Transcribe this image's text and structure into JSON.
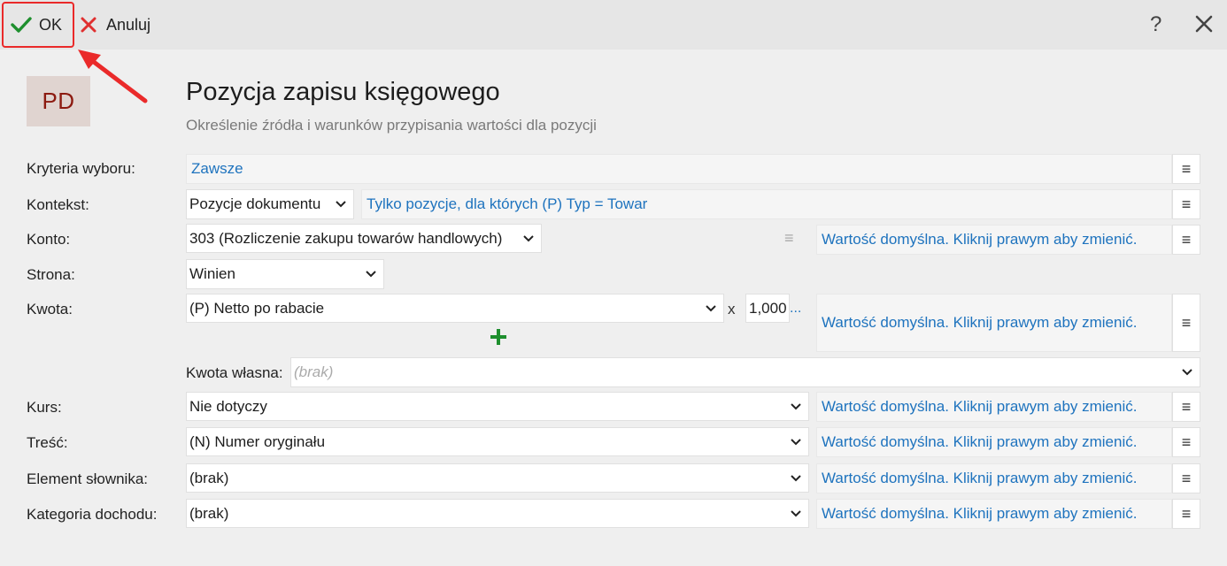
{
  "toolbar": {
    "ok_label": "OK",
    "cancel_label": "Anuluj",
    "help_label": "?",
    "ok_icon": "checkmark-icon",
    "cancel_icon": "close-x-icon",
    "close_icon": "close-icon",
    "colors": {
      "ok": "#1e8f2e",
      "cancel": "#e03030",
      "highlight": "#ea2a2a"
    }
  },
  "header": {
    "avatar": "PD",
    "title": "Pozycja zapisu księgowego",
    "subtitle": "Określenie źródła i warunków przypisania wartości dla pozycji"
  },
  "form": {
    "kryteria": {
      "label": "Kryteria wyboru:",
      "value": "Zawsze"
    },
    "kontekst": {
      "label": "Kontekst:",
      "value": "Pozycje dokumentu",
      "condition": "Tylko pozycje, dla których (P) Typ = Towar"
    },
    "konto": {
      "label": "Konto:",
      "value": "303 (Rozliczenie zakupu towarów handlowych)",
      "default_text": "Wartość domyślna. Kliknij prawym aby zmienić."
    },
    "strona": {
      "label": "Strona:",
      "value": "Winien"
    },
    "kwota": {
      "label": "Kwota:",
      "value": "(P) Netto po rabacie",
      "times": "x",
      "multiplier": "1,000",
      "ellipsis": "...",
      "default_text": "Wartość domyślna. Kliknij prawym aby zmienić."
    },
    "kwota_wlasna": {
      "label": "Kwota własna:",
      "placeholder": "(brak)"
    },
    "kurs": {
      "label": "Kurs:",
      "value": "Nie dotyczy",
      "default_text": "Wartość domyślna. Kliknij prawym aby zmienić."
    },
    "tresc": {
      "label": "Treść:",
      "value": "(N) Numer oryginału",
      "default_text": "Wartość domyślna. Kliknij prawym aby zmienić."
    },
    "element": {
      "label": "Element słownika:",
      "value": "(brak)",
      "default_text": "Wartość domyślna. Kliknij prawym aby zmienić."
    },
    "kategoria": {
      "label": "Kategoria dochodu:",
      "value": "(brak)",
      "default_text": "Wartość domyślna. Kliknij prawym aby zmienić."
    }
  },
  "menu_glyph": "≡"
}
